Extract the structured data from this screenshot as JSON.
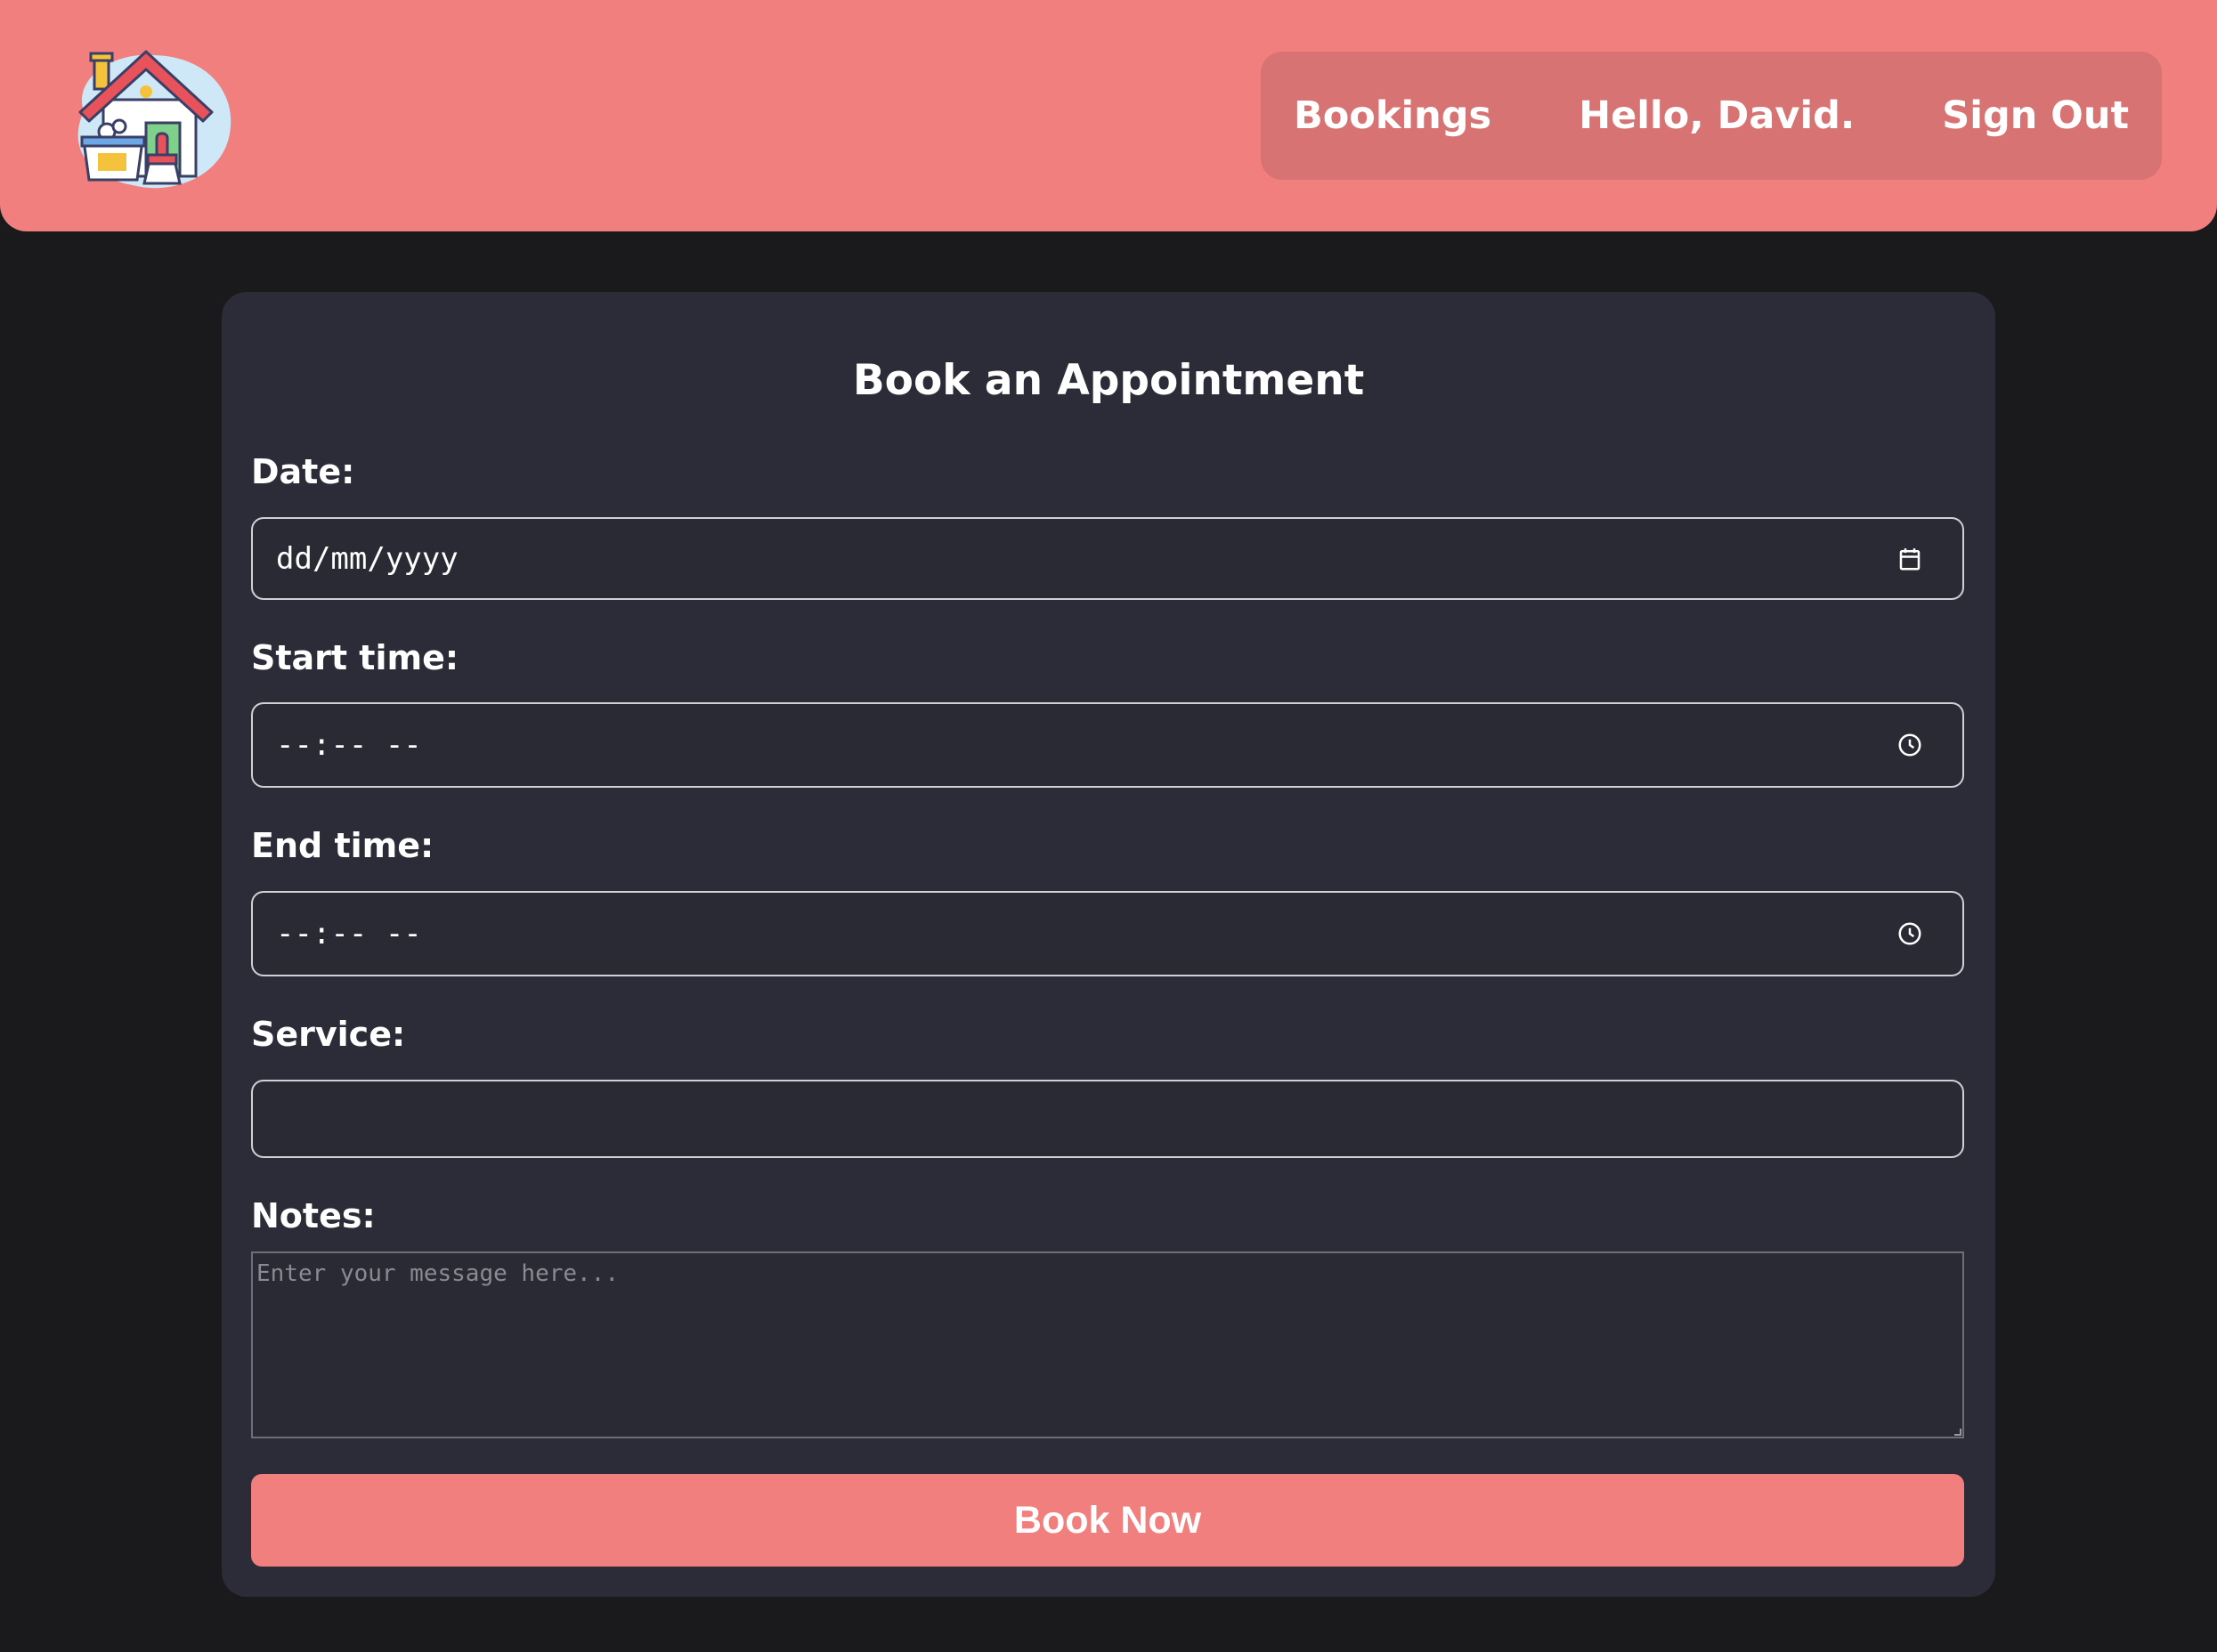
{
  "colors": {
    "accent": "#f07f7e",
    "nav_background": "#d87373",
    "page_background": "#1a1a1d",
    "card_background": "#2c2c39"
  },
  "header": {
    "logo_icon": "house-cleaning-logo-icon",
    "nav": {
      "bookings_label": "Bookings",
      "greeting": "Hello, David.",
      "sign_out_label": "Sign Out"
    }
  },
  "form": {
    "title": "Book an Appointment",
    "date": {
      "label": "Date:",
      "value": "dd/mm/yyyy",
      "icon": "calendar-icon"
    },
    "start_time": {
      "label": "Start time:",
      "value": "--:-- --",
      "icon": "clock-icon"
    },
    "end_time": {
      "label": "End time:",
      "value": "--:-- --",
      "icon": "clock-icon"
    },
    "service": {
      "label": "Service:",
      "value": ""
    },
    "notes": {
      "label": "Notes:",
      "placeholder": "Enter your message here..."
    },
    "submit_label": "Book Now"
  }
}
